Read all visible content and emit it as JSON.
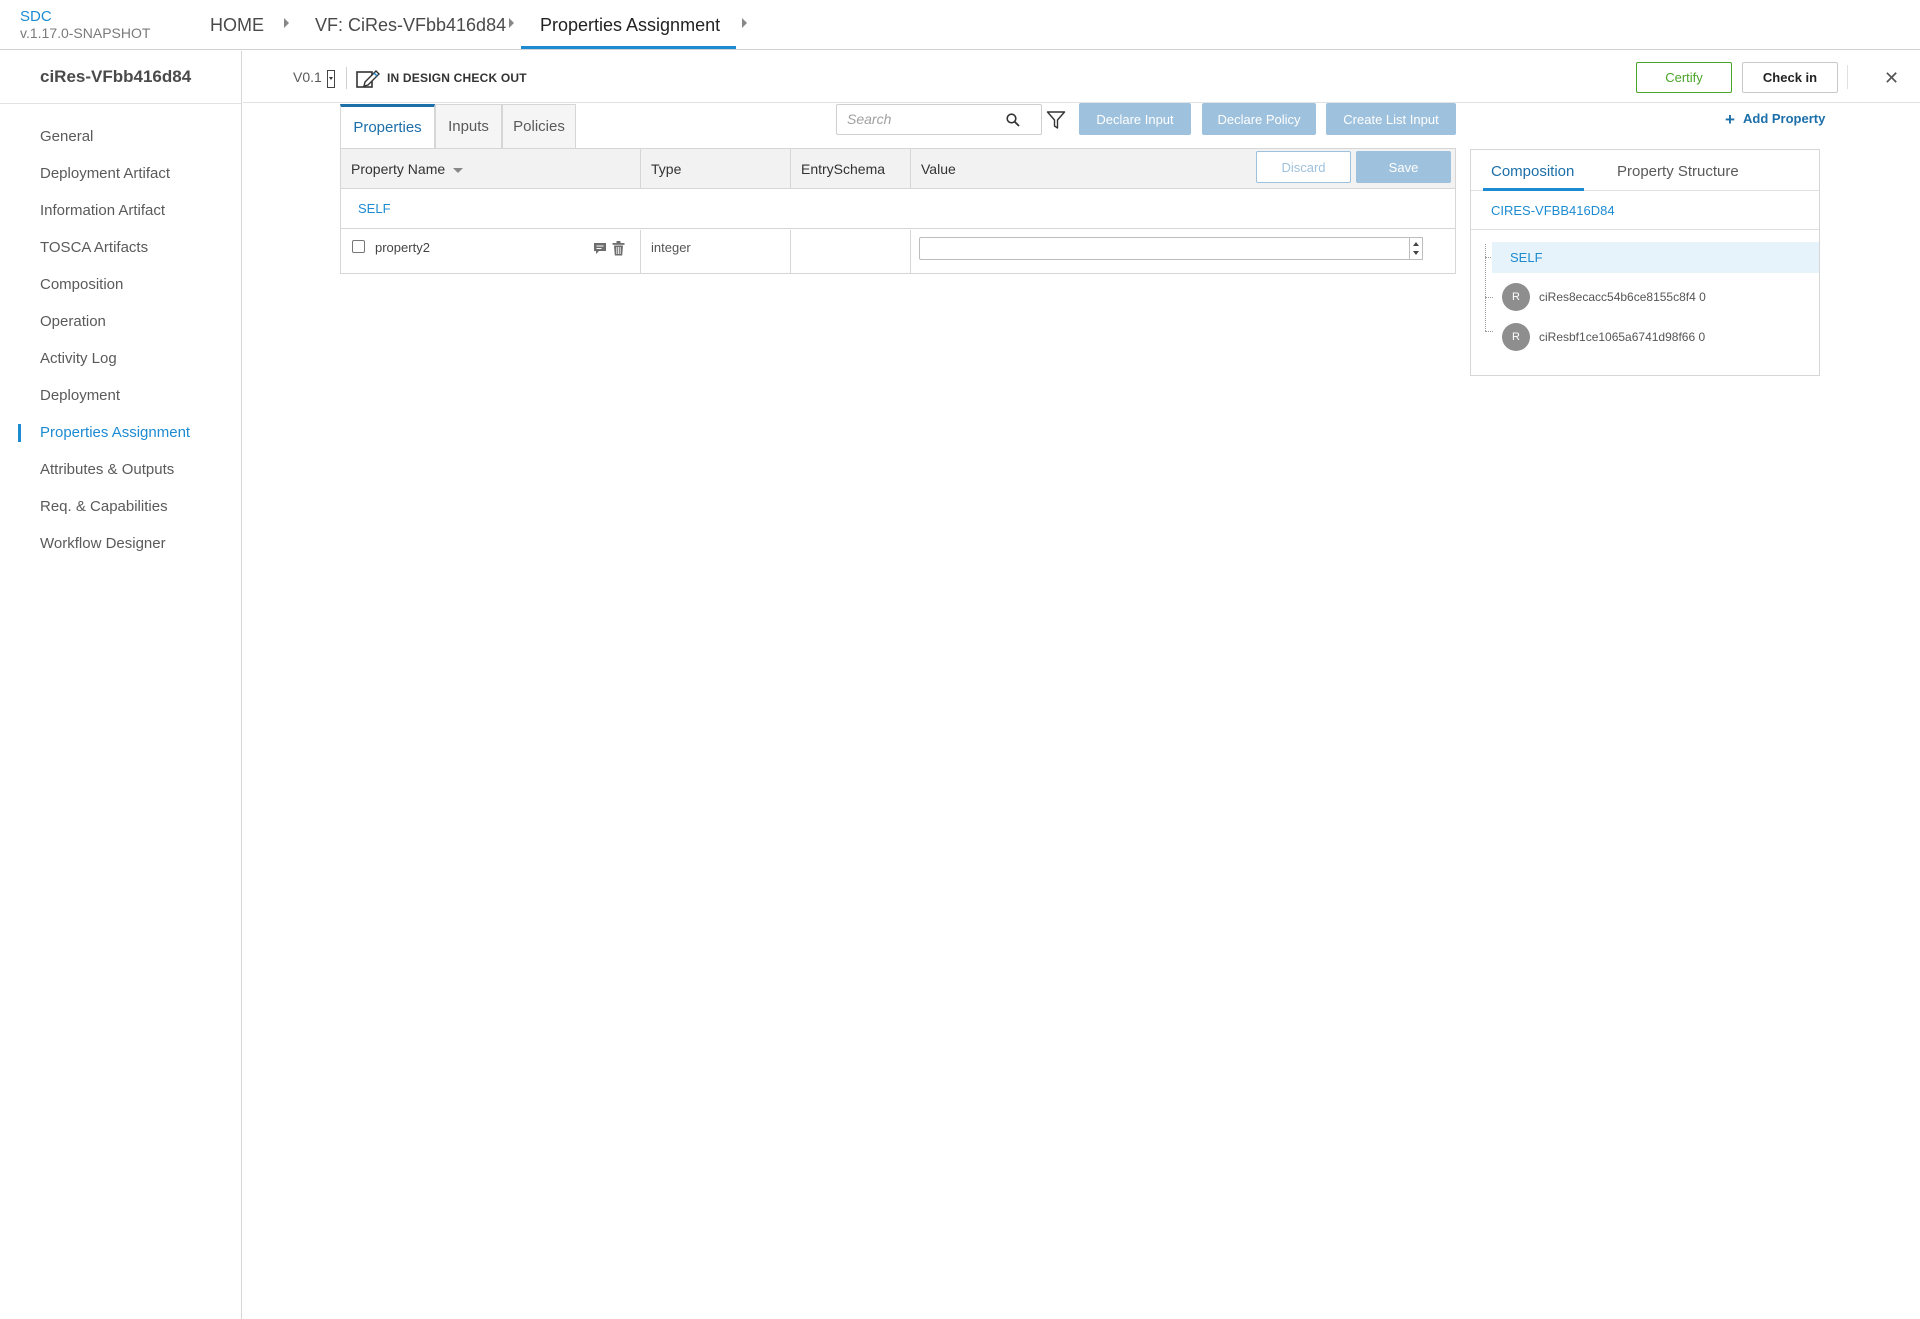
{
  "app": {
    "name": "SDC",
    "version": "v.1.17.0-SNAPSHOT"
  },
  "breadcrumb": {
    "home": "HOME",
    "resource": "VF: CiRes-VFbb416d84",
    "current": "Properties Assignment"
  },
  "sidebar": {
    "title": "ciRes-VFbb416d84",
    "items": [
      {
        "label": "General"
      },
      {
        "label": "Deployment Artifact"
      },
      {
        "label": "Information Artifact"
      },
      {
        "label": "TOSCA Artifacts"
      },
      {
        "label": "Composition"
      },
      {
        "label": "Operation"
      },
      {
        "label": "Activity Log"
      },
      {
        "label": "Deployment"
      },
      {
        "label": "Properties Assignment",
        "active": true
      },
      {
        "label": "Attributes & Outputs"
      },
      {
        "label": "Req. & Capabilities"
      },
      {
        "label": "Workflow Designer"
      }
    ]
  },
  "workspace": {
    "version": "V0.1",
    "lifecycle_state": "IN DESIGN CHECK OUT",
    "certify_label": "Certify",
    "checkin_label": "Check in",
    "close_label": "✕"
  },
  "tabs": [
    {
      "label": "Properties",
      "active": true
    },
    {
      "label": "Inputs"
    },
    {
      "label": "Policies"
    }
  ],
  "search": {
    "placeholder": "Search",
    "value": ""
  },
  "actions": {
    "declare_input": "Declare Input",
    "declare_policy": "Declare Policy",
    "create_list_input": "Create List Input",
    "add_property": "Add Property"
  },
  "table": {
    "columns": [
      "Property Name",
      "Type",
      "EntrySchema",
      "Value"
    ],
    "discard_label": "Discard",
    "save_label": "Save",
    "group_label": "SELF",
    "rows": [
      {
        "name": "property2",
        "type": "integer",
        "entry_schema": "",
        "value": ""
      }
    ]
  },
  "right_panel": {
    "tabs": [
      {
        "label": "Composition",
        "active": true
      },
      {
        "label": "Property Structure"
      }
    ],
    "component": "CIRES-VFBB416D84",
    "tree": {
      "root": "SELF",
      "children": [
        {
          "avatar": "R",
          "label": "ciRes8ecacc54b6ce8155c8f4 0"
        },
        {
          "avatar": "R",
          "label": "ciResbf1ce1065a6741d98f66 0"
        }
      ]
    }
  },
  "colors": {
    "accent": "#1c8bd2",
    "certify": "#4ba42a",
    "disabled_button": "#9ec1dd"
  }
}
